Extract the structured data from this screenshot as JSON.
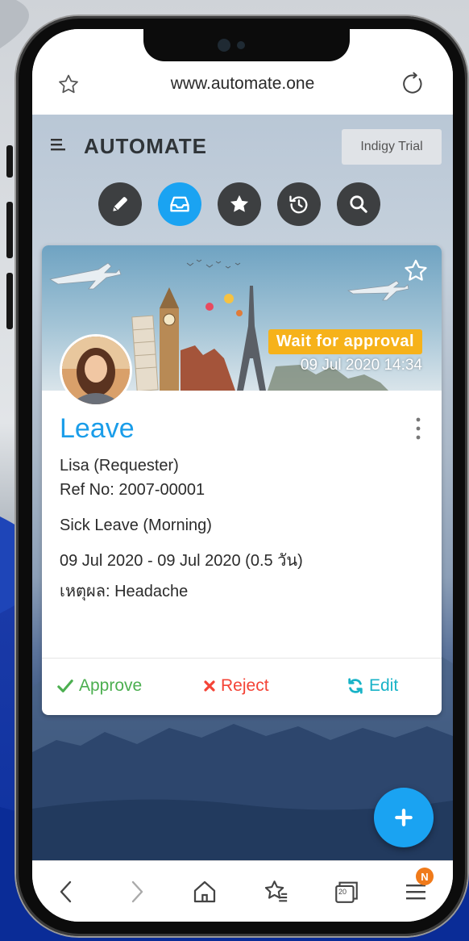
{
  "browser": {
    "url": "www.automate.one"
  },
  "app": {
    "brand": "AUTOMATE",
    "trial_label": "Indigy Trial",
    "toolbar": [
      {
        "icon": "pencil-icon",
        "active": false
      },
      {
        "icon": "inbox-icon",
        "active": true
      },
      {
        "icon": "star-icon",
        "active": false
      },
      {
        "icon": "history-icon",
        "active": false
      },
      {
        "icon": "search-icon",
        "active": false
      }
    ]
  },
  "card": {
    "status": "Wait for approval",
    "datetime": "09 Jul 2020 14:34",
    "title": "Leave",
    "requester": "Lisa (Requester)",
    "ref": "Ref No: 2007-00001",
    "leave_type": "Sick Leave (Morning)",
    "period": "09 Jul 2020 - 09 Jul 2020 (0.5 วัน)",
    "reason": "เหตุผล: Headache",
    "actions": {
      "approve": "Approve",
      "reject": "Reject",
      "edit": "Edit"
    }
  },
  "bottom_nav": {
    "tabs_count": "20",
    "badge": "N"
  },
  "colors": {
    "accent": "#1aa3f2",
    "approve": "#4caf50",
    "reject": "#f44336",
    "edit": "#18b3c7",
    "status": "#f6b21a",
    "badge": "#f07a1a"
  }
}
